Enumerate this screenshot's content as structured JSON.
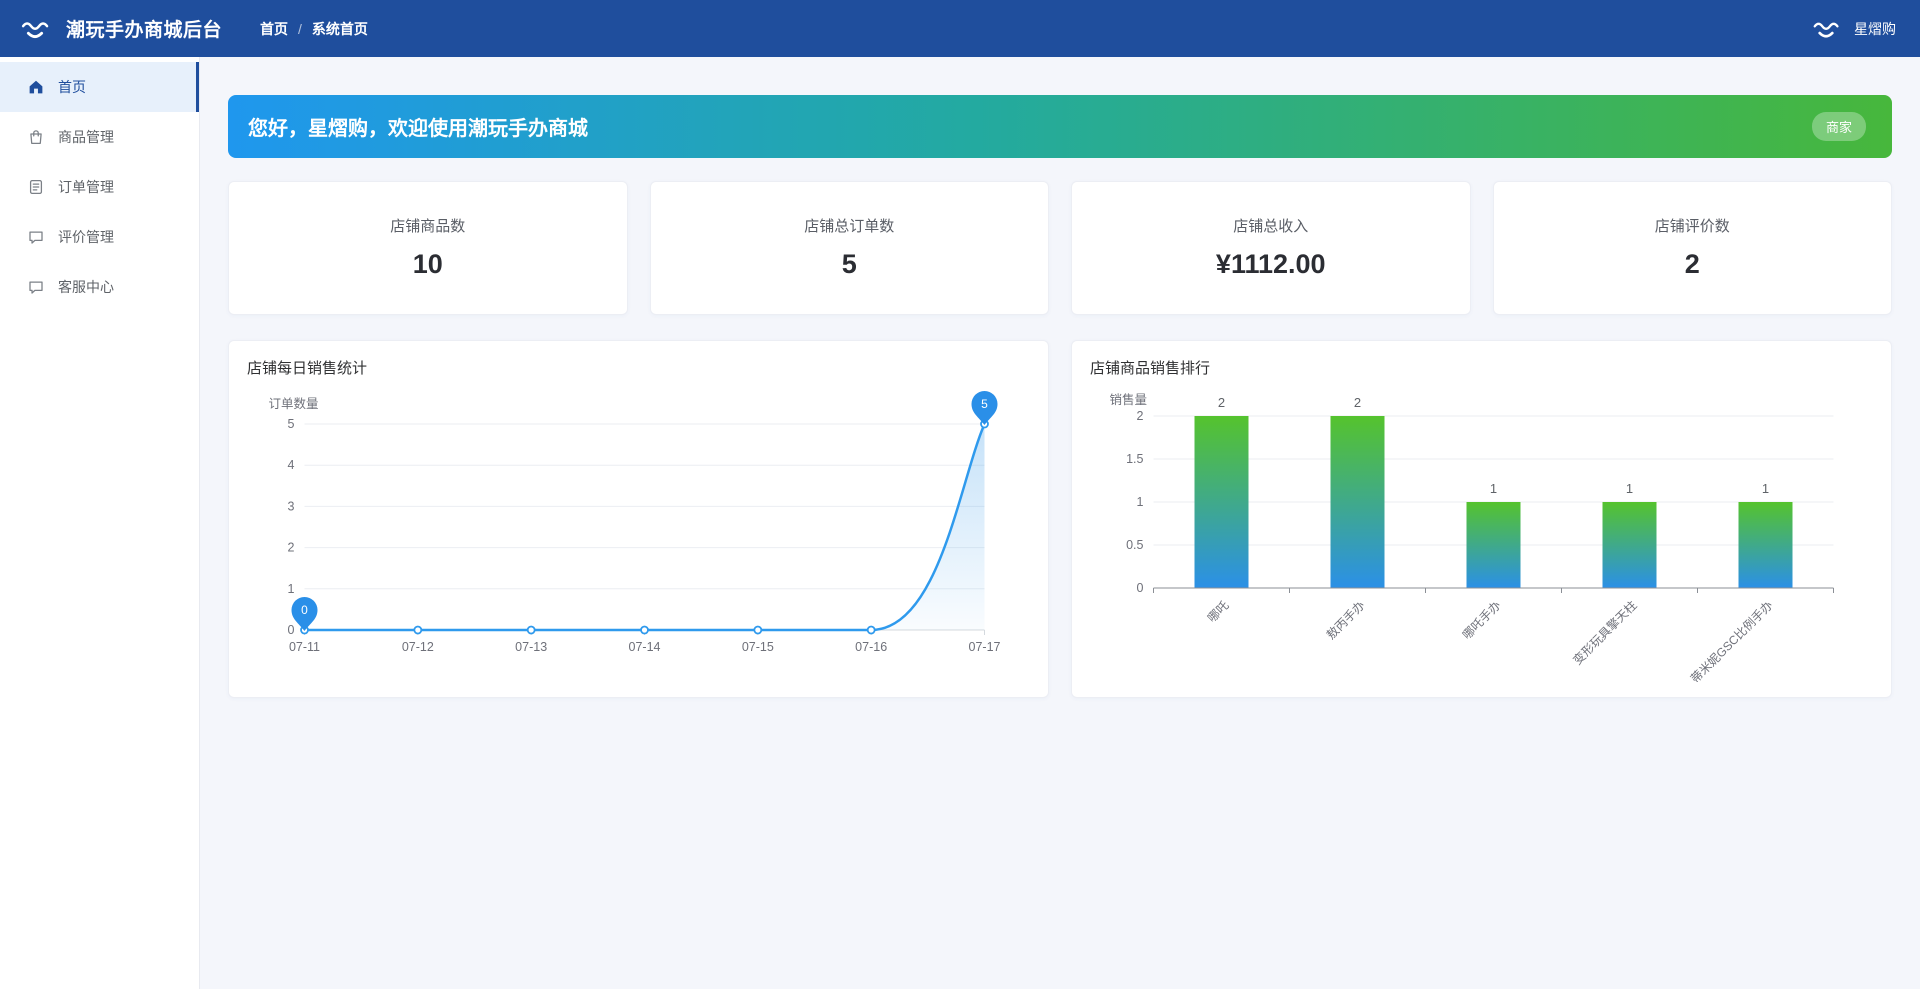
{
  "navbar": {
    "title": "潮玩手办商城后台",
    "breadcrumb": [
      "首页",
      "系统首页"
    ],
    "breadcrumb_separator": "/",
    "username": "星熠购"
  },
  "sidebar": {
    "items": [
      {
        "label": "首页",
        "icon": "home-icon",
        "active": true
      },
      {
        "label": "商品管理",
        "icon": "bag-icon",
        "active": false
      },
      {
        "label": "订单管理",
        "icon": "document-icon",
        "active": false
      },
      {
        "label": "评价管理",
        "icon": "comment-icon",
        "active": false
      },
      {
        "label": "客服中心",
        "icon": "chat-icon",
        "active": false
      }
    ]
  },
  "banner": {
    "greeting": "您好，星熠购，欢迎使用潮玩手办商城",
    "badge": "商家",
    "gradient_from": "#1f97ee",
    "gradient_to": "#47b73c"
  },
  "stats": [
    {
      "label": "店铺商品数",
      "value": "10"
    },
    {
      "label": "店铺总订单数",
      "value": "5"
    },
    {
      "label": "店铺总收入",
      "value": "¥1112.00"
    },
    {
      "label": "店铺评价数",
      "value": "2"
    }
  ],
  "colors": {
    "navbar_bg": "#1f4e9d",
    "page_bg": "#f4f6fb",
    "sidebar_active_bg": "#e7f0fb",
    "logo_orange_from": "#f9a851",
    "logo_orange_to": "#ec6a1f"
  },
  "chart_data": [
    {
      "type": "line",
      "title": "店铺每日销售统计",
      "ylabel": "订单数量",
      "x": [
        "07-11",
        "07-12",
        "07-13",
        "07-14",
        "07-15",
        "07-16",
        "07-17"
      ],
      "values": [
        0,
        0,
        0,
        0,
        0,
        0,
        5
      ],
      "ylim": [
        0,
        5
      ],
      "yticks": [
        0,
        1,
        2,
        3,
        4,
        5
      ],
      "grid": true,
      "smooth": true,
      "area": true,
      "mark_points": [
        {
          "index": 0,
          "label": "0"
        },
        {
          "index": 6,
          "label": "5"
        }
      ],
      "line_color": "#2f9aed",
      "area_color": "#409eea",
      "pin_color": "#2a8fe8",
      "axis_color": "#d4d9de",
      "grid_color": "#ebeef2",
      "text_color": "#6e7079"
    },
    {
      "type": "bar",
      "title": "店铺商品销售排行",
      "ylabel": "销售量",
      "categories": [
        "哪吒",
        "敖丙手办",
        "哪吒手办",
        "变形玩具擎天柱",
        "蒂米妮GSC比例手办"
      ],
      "values": [
        2,
        2,
        1,
        1,
        1
      ],
      "ylim": [
        0,
        2
      ],
      "yticks": [
        0,
        0.5,
        1,
        1.5,
        2
      ],
      "value_labels": [
        2,
        2,
        1,
        1,
        1
      ],
      "label_rotation": -45,
      "bar_gradient_top": "#55c32d",
      "bar_gradient_bottom": "#2b90e7",
      "axis_color": "#8b8f96",
      "grid_color": "#ebeef2",
      "text_color": "#6e7079"
    }
  ]
}
